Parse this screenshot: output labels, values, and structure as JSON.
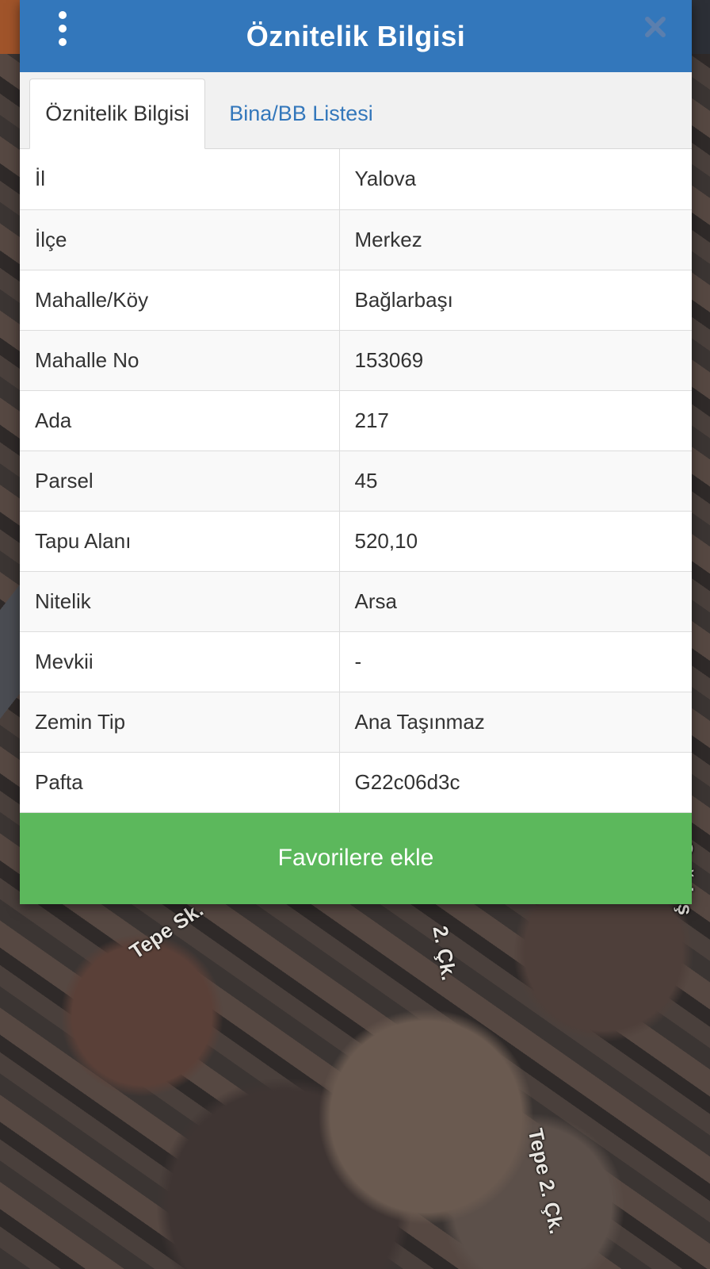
{
  "dialog": {
    "title": "Öznitelik Bilgisi",
    "menu_icon": "vertical-ellipsis-icon",
    "close_icon": "close-x-icon"
  },
  "tabs": [
    {
      "label": "Öznitelik Bilgisi",
      "active": true
    },
    {
      "label": "Bina/BB Listesi",
      "active": false
    }
  ],
  "attributes": [
    {
      "key": "İl",
      "value": "Yalova"
    },
    {
      "key": "İlçe",
      "value": "Merkez"
    },
    {
      "key": "Mahalle/Köy",
      "value": "Bağlarbaşı"
    },
    {
      "key": "Mahalle No",
      "value": "153069"
    },
    {
      "key": "Ada",
      "value": "217"
    },
    {
      "key": "Parsel",
      "value": "45"
    },
    {
      "key": "Tapu Alanı",
      "value": "520,10"
    },
    {
      "key": "Nitelik",
      "value": "Arsa"
    },
    {
      "key": "Mevkii",
      "value": "-"
    },
    {
      "key": "Zemin Tip",
      "value": "Ana Taşınmaz"
    },
    {
      "key": "Pafta",
      "value": "G22c06d3c"
    }
  ],
  "favorite_button": {
    "label": "Favorilere ekle"
  },
  "map_labels": {
    "street_1": "Tepe Sk.",
    "street_2": "2. Çk.",
    "street_3": "Tepe 2. Çk.",
    "street_4": "Çağdaş"
  },
  "colors": {
    "header": "#3377bb",
    "favorite_button": "#5cb85c",
    "close_icon": "#5b7fae",
    "inactive_tab_text": "#3377bb"
  }
}
